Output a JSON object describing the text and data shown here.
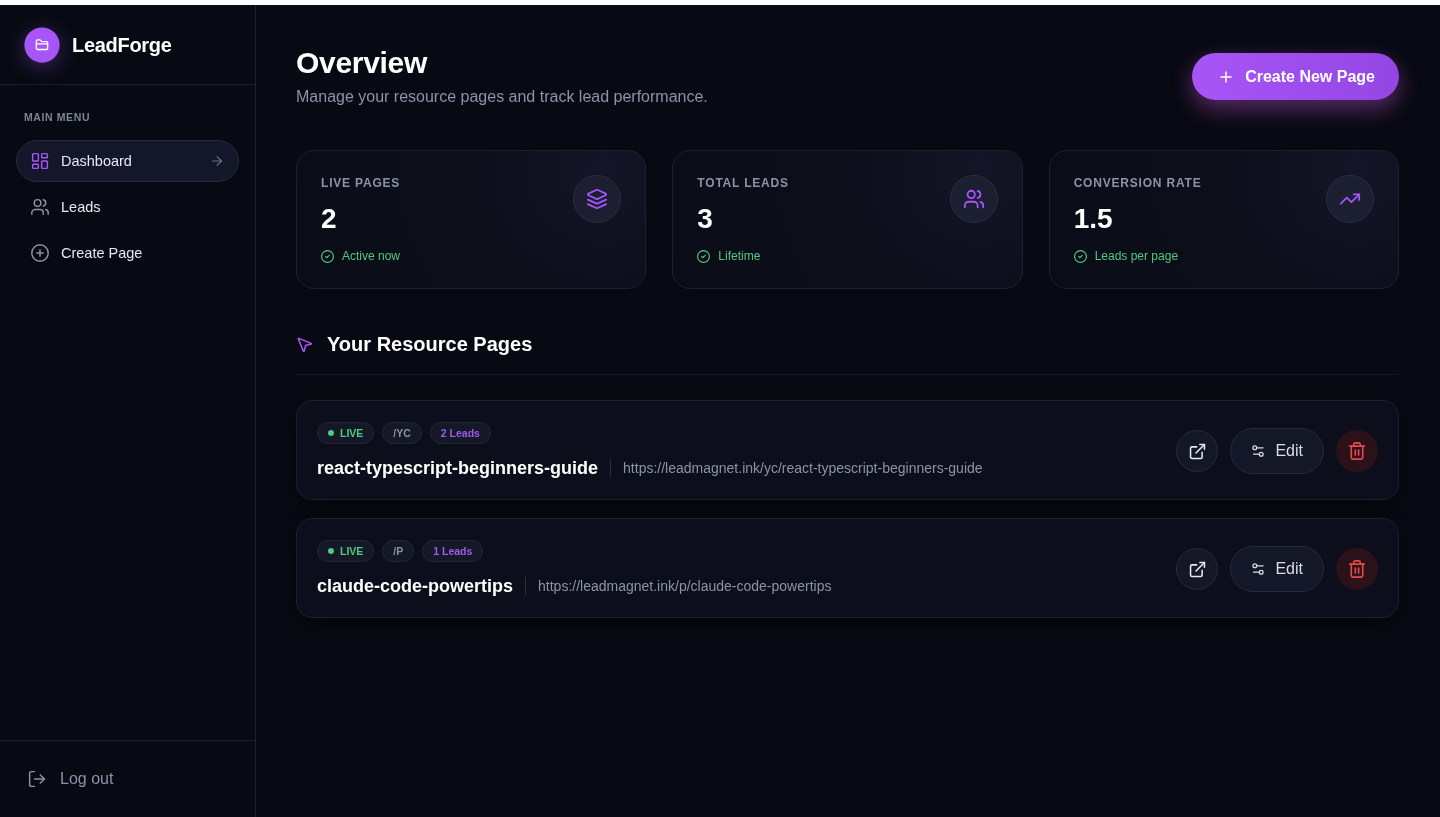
{
  "app": {
    "name": "LeadForge"
  },
  "sidebar": {
    "section_label": "MAIN MENU",
    "items": [
      {
        "label": "Dashboard",
        "selected": true
      },
      {
        "label": "Leads",
        "selected": false
      },
      {
        "label": "Create Page",
        "selected": false
      }
    ],
    "logout": {
      "label": "Log out"
    }
  },
  "header": {
    "title": "Overview",
    "subtitle": "Manage your resource pages and track lead performance.",
    "create_button": {
      "label": "Create New Page"
    }
  },
  "stats": [
    {
      "label": "LIVE PAGES",
      "value": "2",
      "note": "Active now"
    },
    {
      "label": "TOTAL LEADS",
      "value": "3",
      "note": "Lifetime"
    },
    {
      "label": "CONVERSION RATE",
      "value": "1.5",
      "note": "Leads per page"
    }
  ],
  "resource_pages": {
    "title": "Your Resource Pages",
    "items": [
      {
        "status": "LIVE",
        "path": "/YC",
        "leads": "2 Leads",
        "name": "react-typescript-beginners-guide",
        "url": "https://leadmagnet.ink/yc/react-typescript-beginners-guide",
        "edit_label": "Edit"
      },
      {
        "status": "LIVE",
        "path": "/P",
        "leads": "1 Leads",
        "name": "claude-code-powertips",
        "url": "https://leadmagnet.ink/p/claude-code-powertips",
        "edit_label": "Edit"
      }
    ]
  }
}
